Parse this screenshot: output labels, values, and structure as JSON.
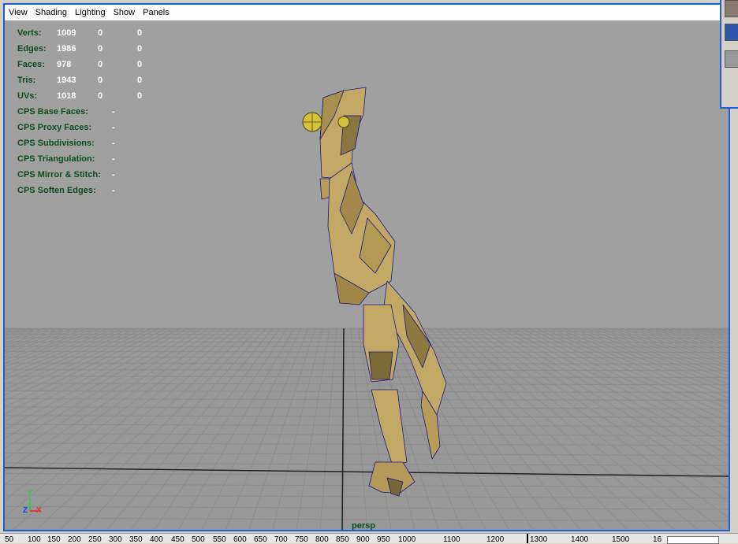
{
  "menu": [
    "View",
    "Shading",
    "Lighting",
    "Show",
    "Panels"
  ],
  "hud": {
    "stats": [
      {
        "label": "Verts:",
        "value": "1009",
        "selected": "0",
        "uv": "0"
      },
      {
        "label": "Edges:",
        "value": "1986",
        "selected": "0",
        "uv": "0"
      },
      {
        "label": "Faces:",
        "value": "978",
        "selected": "0",
        "uv": "0"
      },
      {
        "label": "Tris:",
        "value": "1943",
        "selected": "0",
        "uv": "0"
      },
      {
        "label": "UVs:",
        "value": "1018",
        "selected": "0",
        "uv": "0"
      }
    ],
    "cps": [
      {
        "label": "CPS Base Faces:",
        "value": "-"
      },
      {
        "label": "CPS Proxy Faces:",
        "value": "-"
      },
      {
        "label": "CPS Subdivisions:",
        "value": "-"
      },
      {
        "label": "CPS Triangulation:",
        "value": "-"
      },
      {
        "label": "CPS Mirror & Stitch:",
        "value": "-"
      },
      {
        "label": "CPS Soften Edges:",
        "value": "-"
      }
    ]
  },
  "camera": "persp",
  "axis": {
    "y": "Y",
    "z": "Z",
    "x": "X"
  },
  "timeline": [
    "50",
    "100",
    "150",
    "200",
    "250",
    "300",
    "350",
    "400",
    "450",
    "500",
    "550",
    "600",
    "650",
    "700",
    "750",
    "800",
    "850",
    "900",
    "950",
    "1000",
    "1100",
    "1200",
    "1300",
    "1400",
    "1500",
    "16"
  ],
  "colors": {
    "viewport_bg": "#a0a0a0",
    "grid": "#8c8c8c",
    "model_fill": "#c2a864",
    "model_edge": "#1a1a80",
    "hud_label": "#0e4d1e",
    "panel_border": "#1c5fd6"
  },
  "icons": [
    "grid-icon",
    "wireframe-model-icon",
    "axis-icon"
  ]
}
